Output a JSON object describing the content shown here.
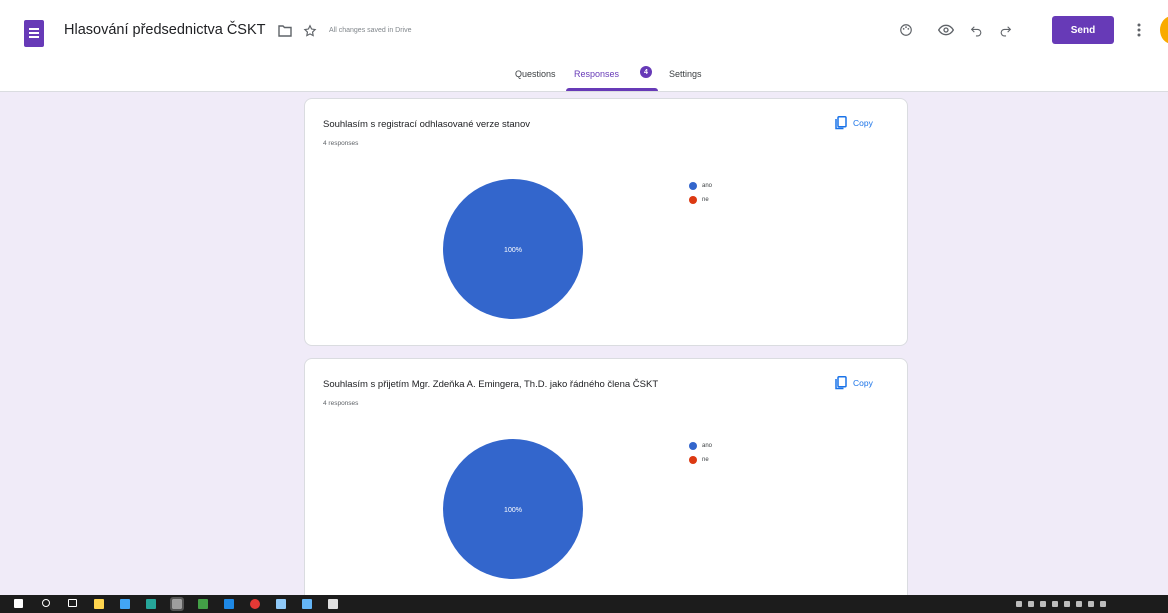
{
  "header": {
    "title": "Hlasování předsednictva ČSKT",
    "save_status": "All changes saved in Drive",
    "send_label": "Send"
  },
  "tabs": [
    {
      "label": "Questions",
      "active": false
    },
    {
      "label": "Responses",
      "active": true,
      "badge": "4"
    },
    {
      "label": "Settings",
      "active": false
    }
  ],
  "colors": {
    "accent": "#673ab7",
    "pie_primary": "#3366cc",
    "pie_secondary": "#dc3912",
    "background": "#f0ebf8"
  },
  "cards": [
    {
      "title": "Souhlasím s registrací odhlasované verze stanov",
      "responses": "4 responses",
      "copy_label": "Copy",
      "pie_label": "100%",
      "legend": [
        {
          "label": "ano",
          "color": "#3366cc"
        },
        {
          "label": "ne",
          "color": "#dc3912"
        }
      ]
    },
    {
      "title": "Souhlasím s přijetím Mgr. Zdeňka A. Emingera, Th.D. jako řádného člena ČSKT",
      "responses": "4 responses",
      "copy_label": "Copy",
      "pie_label": "100%",
      "legend": [
        {
          "label": "ano",
          "color": "#3366cc"
        },
        {
          "label": "ne",
          "color": "#dc3912"
        }
      ]
    }
  ],
  "icons": [
    "forms-icon",
    "folder-icon",
    "star-icon",
    "palette-icon",
    "preview-eye-icon",
    "undo-icon",
    "redo-icon",
    "more-vert-icon",
    "copy-icon"
  ]
}
